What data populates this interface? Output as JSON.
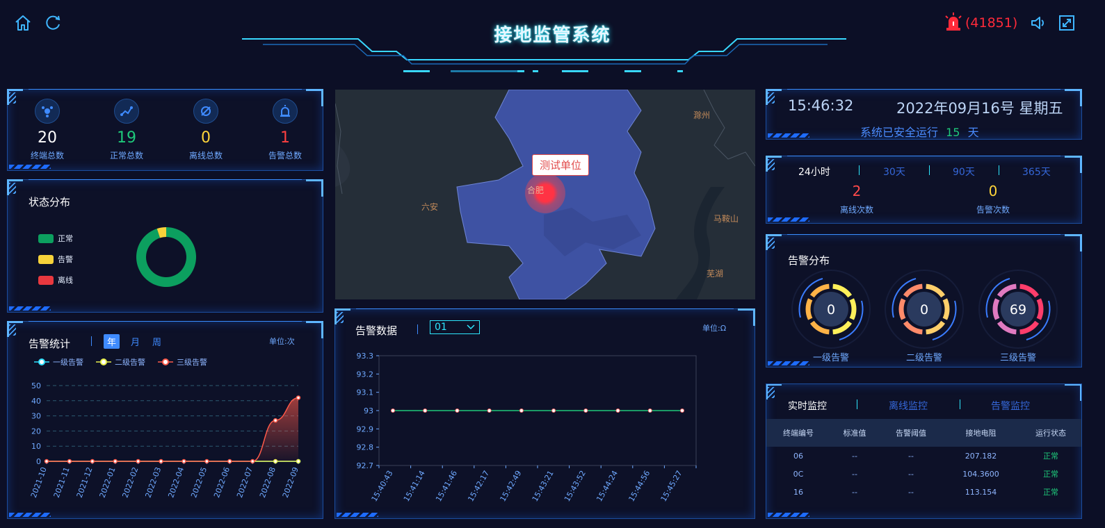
{
  "header": {
    "title": "接地监管系统",
    "alarm_count": "(41851)"
  },
  "stats": [
    {
      "value": "20",
      "label": "终端总数",
      "color": "#ffffff"
    },
    {
      "value": "19",
      "label": "正常总数",
      "color": "#1ec97a"
    },
    {
      "value": "0",
      "label": "离线总数",
      "color": "#ffd53a"
    },
    {
      "value": "1",
      "label": "告警总数",
      "color": "#ff4040"
    }
  ],
  "status_panel": {
    "title": "状态分布",
    "legend": [
      {
        "label": "正常",
        "color": "#0c9f5f",
        "value": 19
      },
      {
        "label": "告警",
        "color": "#f7d23a",
        "value": 1
      },
      {
        "label": "离线",
        "color": "#e8383f",
        "value": 0
      }
    ]
  },
  "alarm_stats": {
    "title": "告警统计",
    "tabs": [
      "年",
      "月",
      "周"
    ],
    "active_tab": "年",
    "unit": "单位:次",
    "chart_data": {
      "type": "line",
      "categories": [
        "2021-10",
        "2021-11",
        "2021-12",
        "2022-01",
        "2022-02",
        "2022-03",
        "2022-04",
        "2022-05",
        "2022-06",
        "2022-07",
        "2022-08",
        "2022-09"
      ],
      "series": [
        {
          "name": "一级告警",
          "color": "#2ee0ff",
          "values": [
            0,
            0,
            0,
            0,
            0,
            0,
            0,
            0,
            0,
            0,
            0,
            0
          ]
        },
        {
          "name": "二级告警",
          "color": "#e8f04c",
          "values": [
            0,
            0,
            0,
            0,
            0,
            0,
            0,
            0,
            0,
            0,
            0,
            0
          ]
        },
        {
          "name": "三级告警",
          "color": "#ff5a4a",
          "values": [
            0,
            0,
            0,
            0,
            0,
            0,
            0,
            0,
            0,
            0,
            27,
            42
          ]
        }
      ],
      "ylim": [
        0,
        50
      ],
      "yticks": [
        0,
        10,
        20,
        30,
        40,
        50
      ],
      "grid": true
    }
  },
  "map": {
    "labels": [
      "滁州",
      "六安",
      "合肥",
      "马鞍山",
      "芜湖"
    ],
    "popup": "测试单位"
  },
  "alarm_data": {
    "title": "告警数据",
    "select_value": "01",
    "unit": "单位:Ω",
    "chart_data": {
      "type": "line",
      "x": [
        "15:40:43",
        "15:41:14",
        "15:41:46",
        "15:42:17",
        "15:42:49",
        "15:43:21",
        "15:43:52",
        "15:44:24",
        "15:44:56",
        "15:45:27"
      ],
      "values": [
        93,
        93,
        93,
        93,
        93,
        93,
        93,
        93,
        93,
        93
      ],
      "ylim": [
        92.7,
        93.3
      ],
      "yticks": [
        "92.7",
        "92.8",
        "92.9",
        "93",
        "93.1",
        "93.2",
        "93.3"
      ],
      "grid": false
    }
  },
  "clock": {
    "time": "15:46:32",
    "date": "2022年09月16号 星期五",
    "run_prefix": "系统已安全运行",
    "run_days": "15",
    "run_suffix": "天"
  },
  "period": {
    "tabs": [
      "24小时",
      "30天",
      "90天",
      "365天"
    ],
    "active": "24小时",
    "offline_value": "2",
    "offline_label": "离线次数",
    "alarm_value": "0",
    "alarm_label": "告警次数"
  },
  "alarm_dist": {
    "title": "告警分布",
    "gauges": [
      {
        "value": "0",
        "label": "一级告警",
        "colors": [
          "#fff05a",
          "#ffb347"
        ]
      },
      {
        "value": "0",
        "label": "二级告警",
        "colors": [
          "#ffcf6a",
          "#ff8b6a"
        ]
      },
      {
        "value": "69",
        "label": "三级告警",
        "colors": [
          "#ff3d6b",
          "#e07ac0"
        ]
      }
    ]
  },
  "monitor": {
    "tabs": [
      "实时监控",
      "离线监控",
      "告警监控"
    ],
    "active": "实时监控",
    "columns": [
      "终端编号",
      "标准值",
      "告警阈值",
      "接地电阻",
      "运行状态"
    ],
    "rows": [
      [
        "06",
        "--",
        "--",
        "207.182",
        "正常"
      ],
      [
        "0C",
        "--",
        "--",
        "104.3600",
        "正常"
      ],
      [
        "16",
        "--",
        "--",
        "113.154",
        "正常"
      ]
    ]
  }
}
